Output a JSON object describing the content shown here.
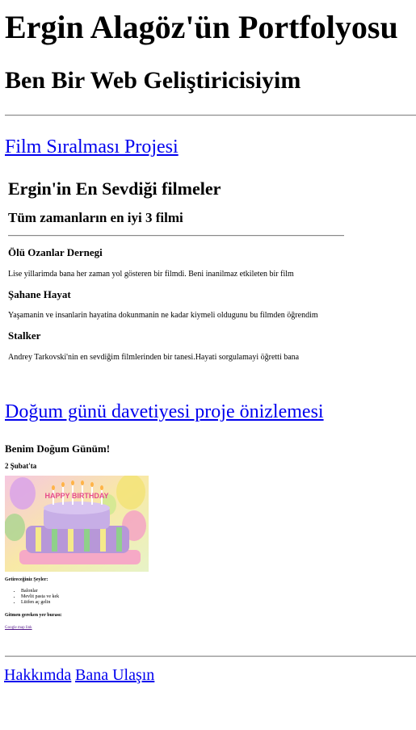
{
  "header": {
    "title": "Ergin Alagöz'ün Portfolyosu",
    "subtitle": "Ben Bir Web Geliştiricisiyim"
  },
  "film_project": {
    "link": "Film Sıralması Projesi",
    "page_title": "Ergin'in En Sevdiği filmeler",
    "page_subtitle": "Tüm zamanların en iyi 3 filmi",
    "movies": [
      {
        "title": "Ölü Ozanlar Dernegi",
        "description": "Lise yillarimda bana her zaman yol gösteren bir filmdi. Beni inanilmaz etkileten bir film"
      },
      {
        "title": "Şahane Hayat",
        "description": "Yaşamanin ve insanlarin hayatina dokunmanin ne kadar kiymeli oldugunu bu filmden öğrendim"
      },
      {
        "title": "Stalker",
        "description": "Andrey Tarkovski'nin en sevdiğim filmlerinden bir tanesi.Hayati sorgulamayi öğretti bana"
      }
    ]
  },
  "birthday_project": {
    "link": "Doğum günü davetiyesi proje önizlemesi",
    "page_title": "Benim Doğum Günüm!",
    "date": "2 Şubat'ta",
    "cake_text": "HAPPY BIRTHDAY",
    "bring_title": "Getireceğiniz Şeyler:",
    "bring_items": [
      "Balonlar",
      "Mevlit pasta ve kek",
      "Lütfen aç gelin"
    ],
    "where_title": "Gitmen gereken yer burası:",
    "map_link": "Google map link"
  },
  "footer": {
    "about": "Hakkımda",
    "contact": "Bana Ulaşın"
  },
  "colors": {
    "link": "#0000ee",
    "visited_link": "#551a8b"
  }
}
